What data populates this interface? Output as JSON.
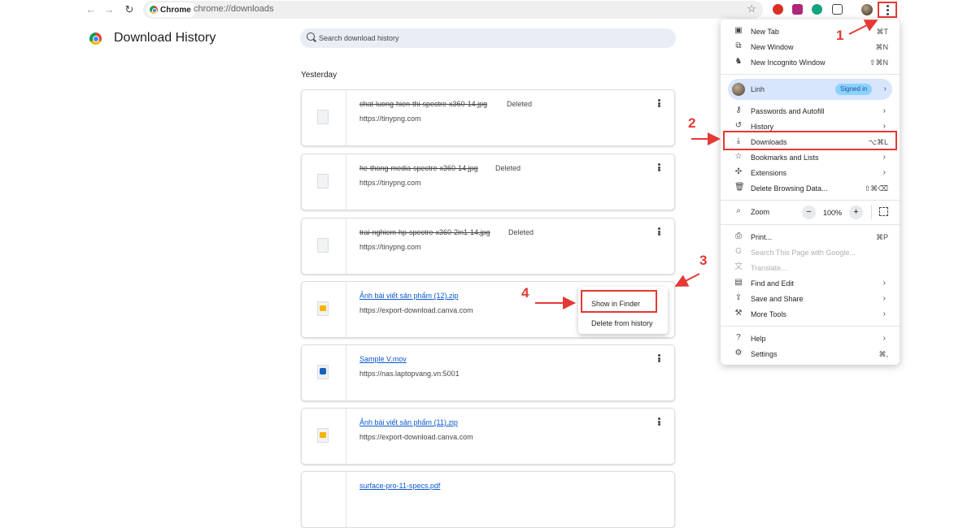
{
  "browser": {
    "chip_label": "Chrome",
    "url": "chrome://downloads"
  },
  "page": {
    "title": "Download History",
    "search_placeholder": "Search download history",
    "date_header": "Yesterday"
  },
  "downloads": [
    {
      "name": "chat-luong-hien-thi-spectre-x360-14.jpg",
      "status": "Deleted",
      "source": "https://tinypng.com"
    },
    {
      "name": "he-thong-media-spectre-x360-14.jpg",
      "status": "Deleted",
      "source": "https://tinypng.com"
    },
    {
      "name": "trai-nghiem-hp-spectre-x360-2in1-14.jpg",
      "status": "Deleted",
      "source": "https://tinypng.com"
    },
    {
      "name": "Ảnh bài viết sản phẩm (12).zip",
      "status": "",
      "source": "https://export-download.canva.com"
    },
    {
      "name": "Sample V.mov",
      "status": "",
      "source": "https://nas.laptopvang.vn:5001"
    },
    {
      "name": "Ảnh bài viết sản phẩm (11).zip",
      "status": "",
      "source": "https://export-download.canva.com"
    },
    {
      "name": "surface-pro-11-specs.pdf",
      "status": "",
      "source": ""
    }
  ],
  "context_menu": {
    "show_in_finder": "Show in Finder",
    "delete_from_history": "Delete from history"
  },
  "chrome_menu": {
    "new_tab": {
      "label": "New Tab",
      "shortcut": "⌘T"
    },
    "new_window": {
      "label": "New Window",
      "shortcut": "⌘N"
    },
    "new_incognito": {
      "label": "New Incognito Window",
      "shortcut": "⇧⌘N"
    },
    "profile": {
      "name": "Linh",
      "badge": "Signed in"
    },
    "passwords": {
      "label": "Passwords and Autofill"
    },
    "history": {
      "label": "History"
    },
    "downloads": {
      "label": "Downloads",
      "shortcut": "⌥⌘L"
    },
    "bookmarks": {
      "label": "Bookmarks and Lists"
    },
    "extensions": {
      "label": "Extensions"
    },
    "delete_data": {
      "label": "Delete Browsing Data...",
      "shortcut": "⇧⌘⌫"
    },
    "zoom": {
      "label": "Zoom",
      "value": "100%",
      "minus": "−",
      "plus": "+"
    },
    "print": {
      "label": "Print...",
      "shortcut": "⌘P"
    },
    "search_page": {
      "label": "Search This Page with Google..."
    },
    "translate": {
      "label": "Translate..."
    },
    "find_edit": {
      "label": "Find and Edit"
    },
    "save_share": {
      "label": "Save and Share"
    },
    "more_tools": {
      "label": "More Tools"
    },
    "help": {
      "label": "Help"
    },
    "settings": {
      "label": "Settings",
      "shortcut": "⌘,"
    }
  },
  "annotations": [
    "1",
    "2",
    "3",
    "4"
  ],
  "colors": {
    "annotation": "#e53935",
    "link": "#0b57d0",
    "signed_in_badge": "#7fcfff"
  }
}
